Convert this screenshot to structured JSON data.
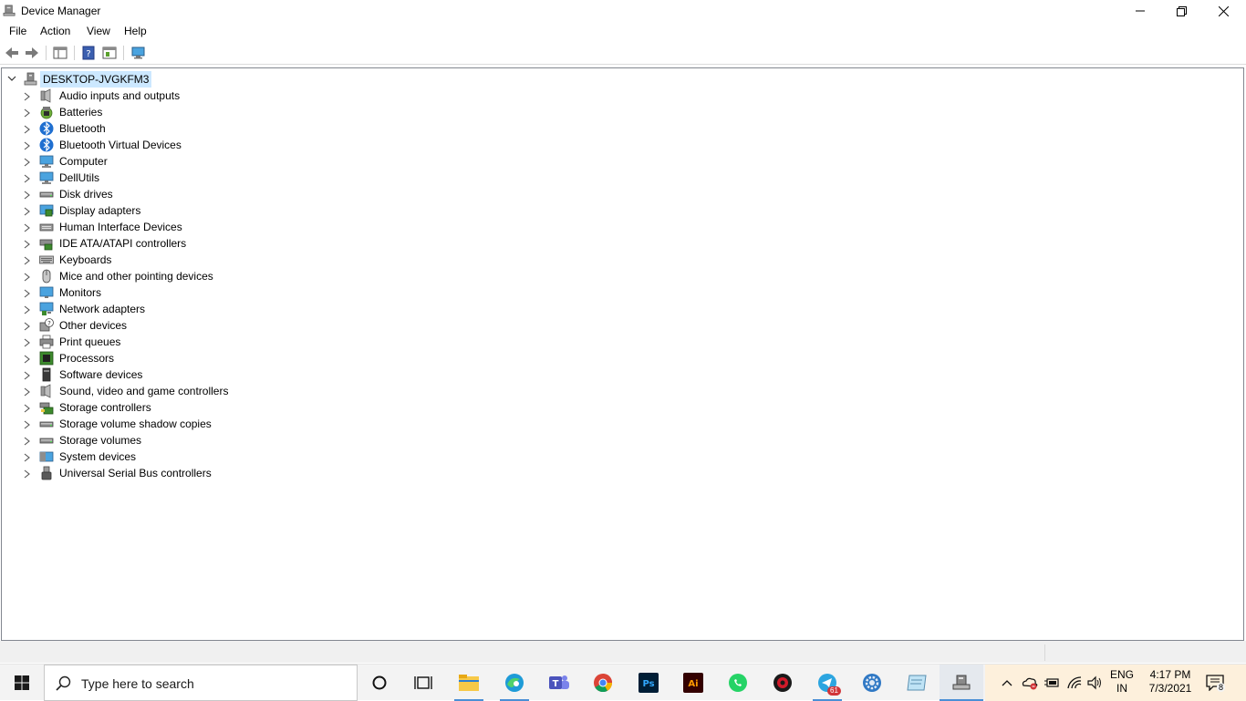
{
  "window": {
    "title": "Device Manager"
  },
  "menu": [
    "File",
    "Action",
    "View",
    "Help"
  ],
  "tree": {
    "root": "DESKTOP-JVGKFM3",
    "items": [
      {
        "label": "Audio inputs and outputs",
        "icon": "speaker-icon"
      },
      {
        "label": "Batteries",
        "icon": "battery-icon"
      },
      {
        "label": "Bluetooth",
        "icon": "bluetooth-icon"
      },
      {
        "label": "Bluetooth Virtual Devices",
        "icon": "bluetooth-icon"
      },
      {
        "label": "Computer",
        "icon": "computer-icon"
      },
      {
        "label": "DellUtils",
        "icon": "computer-icon"
      },
      {
        "label": "Disk drives",
        "icon": "disk-drive-icon"
      },
      {
        "label": "Display adapters",
        "icon": "display-adapter-icon"
      },
      {
        "label": "Human Interface Devices",
        "icon": "hid-icon"
      },
      {
        "label": "IDE ATA/ATAPI controllers",
        "icon": "ide-controller-icon"
      },
      {
        "label": "Keyboards",
        "icon": "keyboard-icon"
      },
      {
        "label": "Mice and other pointing devices",
        "icon": "mouse-icon"
      },
      {
        "label": "Monitors",
        "icon": "monitor-icon"
      },
      {
        "label": "Network adapters",
        "icon": "network-adapter-icon"
      },
      {
        "label": "Other devices",
        "icon": "unknown-device-icon"
      },
      {
        "label": "Print queues",
        "icon": "printer-icon"
      },
      {
        "label": "Processors",
        "icon": "processor-icon"
      },
      {
        "label": "Software devices",
        "icon": "software-device-icon"
      },
      {
        "label": "Sound, video and game controllers",
        "icon": "speaker-icon"
      },
      {
        "label": "Storage controllers",
        "icon": "storage-controller-icon"
      },
      {
        "label": "Storage volume shadow copies",
        "icon": "disk-drive-icon"
      },
      {
        "label": "Storage volumes",
        "icon": "disk-drive-icon"
      },
      {
        "label": "System devices",
        "icon": "system-device-icon"
      },
      {
        "label": "Universal Serial Bus controllers",
        "icon": "usb-icon"
      }
    ]
  },
  "taskbar": {
    "search_placeholder": "Type here to search",
    "apps": [
      "cortana-icon",
      "task-view-icon",
      "file-explorer-icon",
      "edge-icon",
      "teams-icon",
      "chrome-icon",
      "photoshop-icon",
      "illustrator-icon",
      "whatsapp-icon",
      "security-app-icon",
      "telegram-icon",
      "settings-gear-icon",
      "notepad-icon",
      "device-manager-icon"
    ],
    "telegram_badge": "61",
    "language_line1": "ENG",
    "language_line2": "IN",
    "time": "4:17 PM",
    "date": "7/3/2021",
    "notification_count": "8"
  }
}
